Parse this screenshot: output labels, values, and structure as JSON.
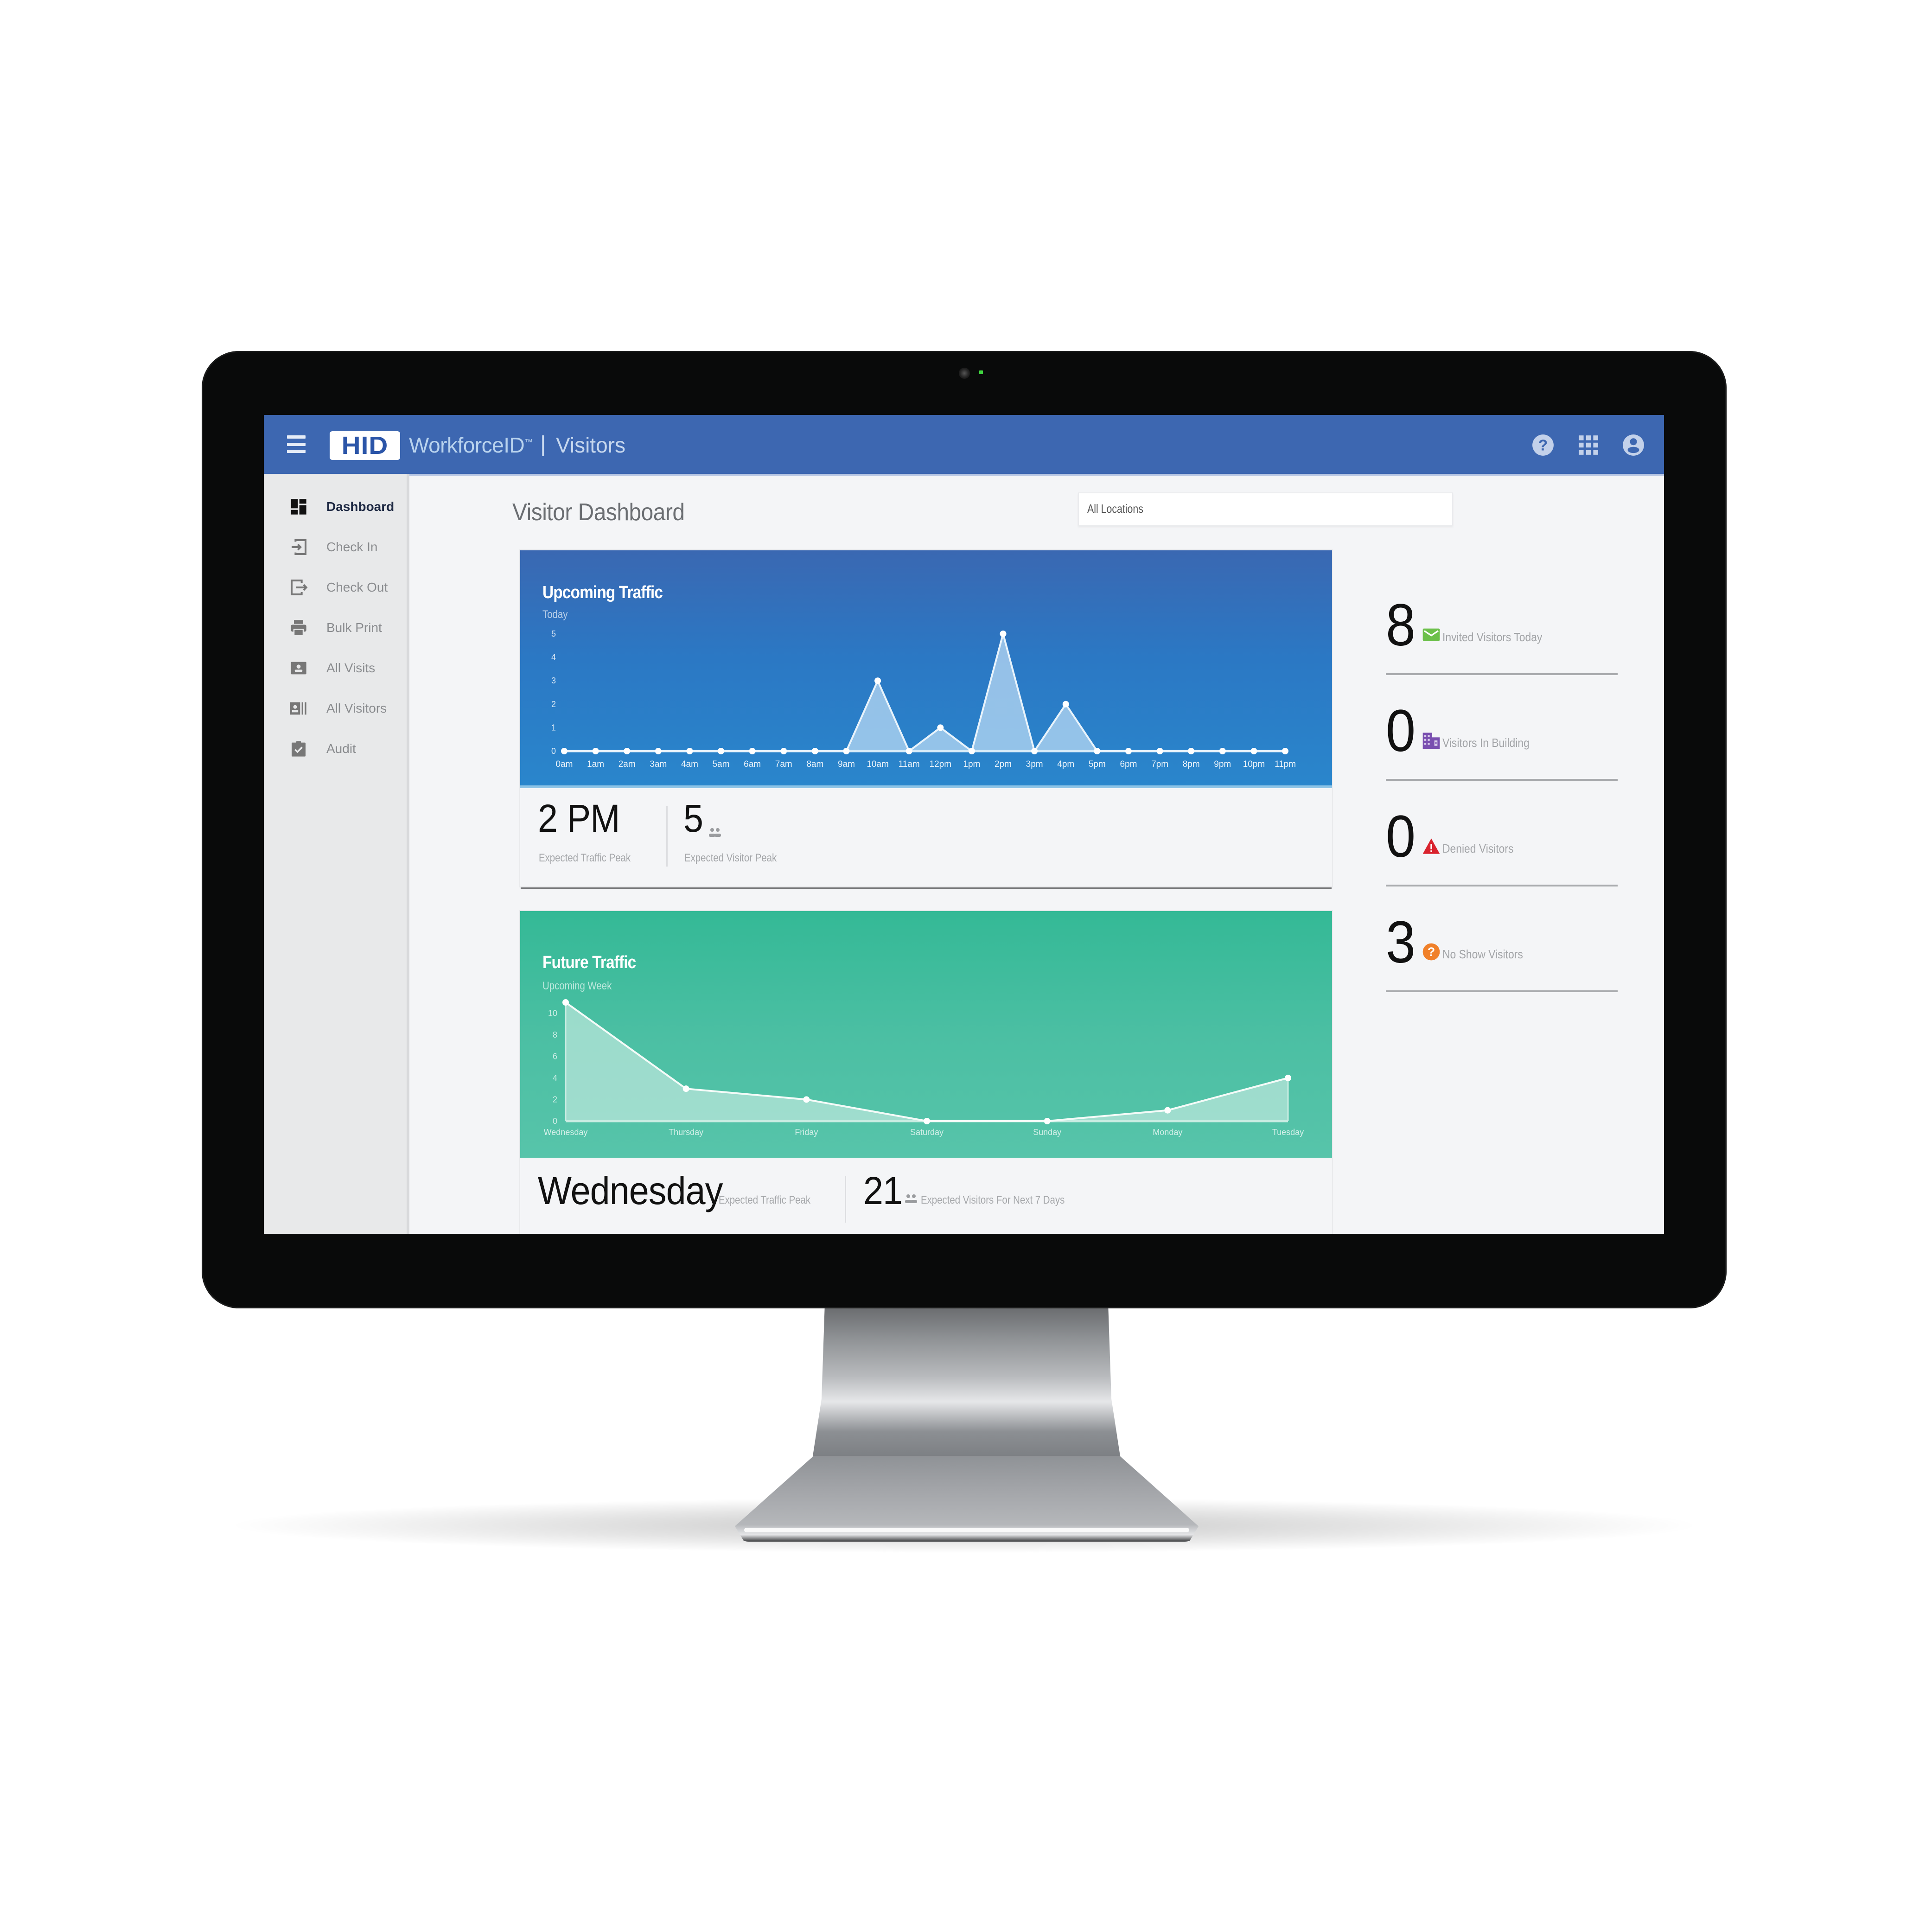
{
  "app": {
    "brand_logo": "HID",
    "product_name": "WorkforceID",
    "trademark": "™",
    "separator": "|",
    "section": "Visitors"
  },
  "header": {
    "icons": [
      "menu-icon",
      "help-icon",
      "apps-grid-icon",
      "account-icon"
    ]
  },
  "sidebar": {
    "items": [
      {
        "label": "Dashboard",
        "icon": "dashboard-icon",
        "active": true
      },
      {
        "label": "Check In",
        "icon": "check-in-icon",
        "active": false
      },
      {
        "label": "Check Out",
        "icon": "check-out-icon",
        "active": false
      },
      {
        "label": "Bulk Print",
        "icon": "printer-icon",
        "active": false
      },
      {
        "label": "All Visits",
        "icon": "visits-card-icon",
        "active": false
      },
      {
        "label": "All Visitors",
        "icon": "visitors-badge-icon",
        "active": false
      },
      {
        "label": "Audit",
        "icon": "clipboard-check-icon",
        "active": false
      }
    ]
  },
  "main": {
    "title": "Visitor Dashboard",
    "location_filter": {
      "value": "All Locations"
    }
  },
  "upcoming": {
    "title": "Upcoming Traffic",
    "subtitle": "Today",
    "peak_value": "2 PM",
    "peak_label": "Expected Traffic Peak",
    "visitor_peak_value": "5",
    "visitor_peak_label": "Expected Visitor Peak"
  },
  "future": {
    "title": "Future Traffic",
    "subtitle": "Upcoming Week",
    "peak_value": "Wednesday",
    "peak_label": "Expected Traffic Peak",
    "total_value": "21",
    "total_label": "Expected Visitors For Next 7 Days"
  },
  "side_stats": [
    {
      "value": "8",
      "label": "Invited Visitors Today",
      "icon": "envelope-icon",
      "color": "#6cc04a"
    },
    {
      "value": "0",
      "label": "Visitors In Building",
      "icon": "building-icon",
      "color": "#7a4fb0"
    },
    {
      "value": "0",
      "label": "Denied Visitors",
      "icon": "warning-icon",
      "color": "#d9232e"
    },
    {
      "value": "3",
      "label": "No Show Visitors",
      "icon": "question-icon",
      "color": "#f0802a"
    }
  ],
  "colors": {
    "header": "#3d67b1",
    "upcoming_card": "#2b78c4",
    "future_card": "#3dbb9c"
  },
  "chart_data": [
    {
      "type": "area",
      "title": "Upcoming Traffic",
      "subtitle": "Today",
      "categories": [
        "0am",
        "1am",
        "2am",
        "3am",
        "4am",
        "5am",
        "6am",
        "7am",
        "8am",
        "9am",
        "10am",
        "11am",
        "12pm",
        "1pm",
        "2pm",
        "3pm",
        "4pm",
        "5pm",
        "6pm",
        "7pm",
        "8pm",
        "9pm",
        "10pm",
        "11pm"
      ],
      "values": [
        0,
        0,
        0,
        0,
        0,
        0,
        0,
        0,
        0,
        0,
        3,
        0,
        1,
        0,
        5,
        0,
        2,
        0,
        0,
        0,
        0,
        0,
        0,
        0
      ],
      "yticks": [
        0,
        1,
        2,
        3,
        4,
        5
      ],
      "ylim": [
        0,
        5
      ],
      "xlabel": "",
      "ylabel": "",
      "grid": false,
      "legend": "none"
    },
    {
      "type": "area",
      "title": "Future Traffic",
      "subtitle": "Upcoming Week",
      "categories": [
        "Wednesday",
        "Thursday",
        "Friday",
        "Saturday",
        "Sunday",
        "Monday",
        "Tuesday"
      ],
      "values": [
        11,
        3,
        2,
        0,
        0,
        1,
        4
      ],
      "yticks": [
        0,
        2,
        4,
        6,
        8,
        10
      ],
      "ylim": [
        0,
        11
      ],
      "xlabel": "",
      "ylabel": "",
      "grid": false,
      "legend": "none"
    }
  ]
}
